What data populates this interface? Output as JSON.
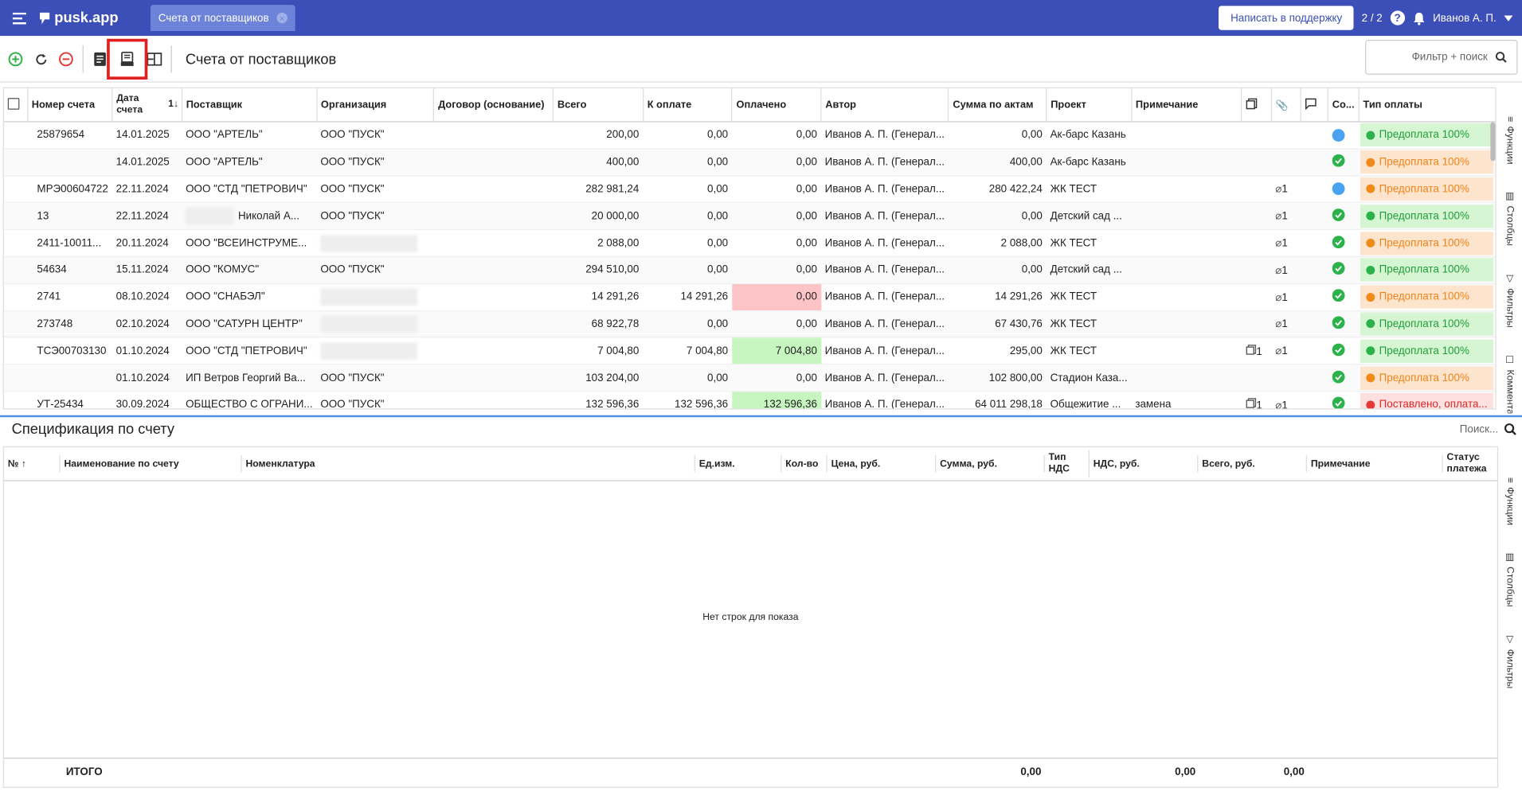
{
  "app": {
    "logo": "pusk.app",
    "tab": "Счета от поставщиков",
    "support": "Написать в поддержку",
    "counter": "2 / 2",
    "user": "Иванов А. П."
  },
  "toolbar": {
    "title": "Счета от поставщиков",
    "filter": "Фильтр + поиск"
  },
  "grid": {
    "headers": [
      "Номер счета",
      "Дата счета",
      "Поставщик",
      "Организация",
      "Договор (основание)",
      "Всего",
      "К оплате",
      "Оплачено",
      "Автор",
      "Сумма по актам",
      "Проект",
      "Примечание",
      "Со...",
      "Тип оплаты"
    ],
    "sort_label": "1",
    "rows": [
      {
        "num": "25879654",
        "date": "14.01.2025",
        "supplier": "ООО \"АРТЕЛЬ\"",
        "org": "ООО \"ПУСК\"",
        "total": "200,00",
        "topay": "0,00",
        "paid": "0,00",
        "author": "Иванов А. П. (Генерал...",
        "acts": "0,00",
        "project": "Ак-барс Казань",
        "note": "",
        "docs": "",
        "att": "",
        "st": "blue",
        "pay": "Предоплата 100%",
        "paycls": "green"
      },
      {
        "num": "",
        "date": "14.01.2025",
        "supplier": "ООО \"АРТЕЛЬ\"",
        "org": "ООО \"ПУСК\"",
        "total": "400,00",
        "topay": "0,00",
        "paid": "0,00",
        "author": "Иванов А. П. (Генерал...",
        "acts": "400,00",
        "project": "Ак-барс Казань",
        "note": "",
        "docs": "",
        "att": "",
        "st": "green",
        "pay": "Предоплата 100%",
        "paycls": "orange"
      },
      {
        "num": "МРЭ00604722",
        "date": "22.11.2024",
        "supplier": "ООО \"СТД \"ПЕТРОВИЧ\"",
        "org": "ООО \"ПУСК\"",
        "total": "282 981,24",
        "topay": "0,00",
        "paid": "0,00",
        "author": "Иванов А. П. (Генерал...",
        "acts": "280 422,24",
        "project": "ЖК ТЕСТ",
        "note": "",
        "docs": "",
        "att": "1",
        "st": "blue",
        "pay": "Предоплата 100%",
        "paycls": "orange"
      },
      {
        "num": "13",
        "date": "22.11.2024",
        "supplier": "Николай А...",
        "org": "ООО \"ПУСК\"",
        "total": "20 000,00",
        "topay": "0,00",
        "paid": "0,00",
        "author": "Иванов А. П. (Генерал...",
        "acts": "0,00",
        "project": "Детский сад ...",
        "note": "",
        "docs": "",
        "att": "1",
        "st": "green",
        "pay": "Предоплата 100%",
        "paycls": "green"
      },
      {
        "num": "2411-10011...",
        "date": "20.11.2024",
        "supplier": "ООО \"ВСЕИНСТРУМЕ...",
        "org": "",
        "total": "2 088,00",
        "topay": "0,00",
        "paid": "0,00",
        "author": "Иванов А. П. (Генерал...",
        "acts": "2 088,00",
        "project": "ЖК ТЕСТ",
        "note": "",
        "docs": "",
        "att": "1",
        "st": "green",
        "pay": "Предоплата 100%",
        "paycls": "orange"
      },
      {
        "num": "54634",
        "date": "15.11.2024",
        "supplier": "ООО \"КОМУС\"",
        "org": "ООО \"ПУСК\"",
        "total": "294 510,00",
        "topay": "0,00",
        "paid": "0,00",
        "author": "Иванов А. П. (Генерал...",
        "acts": "0,00",
        "project": "Детский сад ...",
        "note": "",
        "docs": "",
        "att": "1",
        "st": "green",
        "pay": "Предоплата 100%",
        "paycls": "green"
      },
      {
        "num": "2741",
        "date": "08.10.2024",
        "supplier": "ООО \"СНАБЭЛ\"",
        "org": "",
        "total": "14 291,26",
        "topay": "14 291,26",
        "paid": "0,00",
        "author": "Иванов А. П. (Генерал...",
        "acts": "14 291,26",
        "project": "ЖК ТЕСТ",
        "note": "",
        "docs": "",
        "att": "1",
        "st": "green",
        "pay": "Предоплата 100%",
        "paycls": "orange",
        "paidcls": "pink"
      },
      {
        "num": "273748",
        "date": "02.10.2024",
        "supplier": "ООО \"САТУРН ЦЕНТР\"",
        "org": "",
        "total": "68 922,78",
        "topay": "0,00",
        "paid": "0,00",
        "author": "Иванов А. П. (Генерал...",
        "acts": "67 430,76",
        "project": "ЖК ТЕСТ",
        "note": "",
        "docs": "",
        "att": "1",
        "st": "green",
        "pay": "Предоплата 100%",
        "paycls": "green"
      },
      {
        "num": "ТСЭ00703130",
        "date": "01.10.2024",
        "supplier": "ООО \"СТД \"ПЕТРОВИЧ\"",
        "org": "",
        "total": "7 004,80",
        "topay": "7 004,80",
        "paid": "7 004,80",
        "author": "Иванов А. П. (Генерал...",
        "acts": "295,00",
        "project": "ЖК ТЕСТ",
        "note": "",
        "docs": "1",
        "att": "1",
        "st": "green",
        "pay": "Предоплата 100%",
        "paycls": "green",
        "paidcls": "greenbg"
      },
      {
        "num": "",
        "date": "01.10.2024",
        "supplier": "ИП Ветров Георгий Ва...",
        "org": "ООО \"ПУСК\"",
        "total": "103 204,00",
        "topay": "0,00",
        "paid": "0,00",
        "author": "Иванов А. П. (Генерал...",
        "acts": "102 800,00",
        "project": "Стадион Каза...",
        "note": "",
        "docs": "",
        "att": "",
        "st": "green",
        "pay": "Предоплата 100%",
        "paycls": "orange"
      },
      {
        "num": "УТ-25434",
        "date": "30.09.2024",
        "supplier": "ОБЩЕСТВО С ОГРАНИ...",
        "org": "ООО \"ПУСК\"",
        "total": "132 596,36",
        "topay": "132 596,36",
        "paid": "132 596,36",
        "author": "Иванов А. П. (Генерал...",
        "acts": "64 011 298,18",
        "project": "Общежитие ...",
        "note": "замена",
        "docs": "1",
        "att": "1",
        "st": "green",
        "pay": "Поставлено, оплата...",
        "paycls": "red",
        "paidcls": "greenbg"
      }
    ]
  },
  "side": {
    "functions": "Функции",
    "columns": "Столбцы",
    "filters": "Фильтры",
    "comments": "Комментарии"
  },
  "spec": {
    "title": "Спецификация по счету",
    "search": "Поиск...",
    "headers": [
      "№",
      "Наименование по счету",
      "Номенклатура",
      "Ед.изм.",
      "Кол-во",
      "Цена, руб.",
      "Сумма, руб.",
      "Тип НДС",
      "НДС, руб.",
      "Всего, руб.",
      "Примечание",
      "Статус платежа"
    ],
    "empty": "Нет строк для показа",
    "total_label": "ИТОГО",
    "total_sum": "0,00",
    "total_vat": "0,00",
    "total_all": "0,00"
  }
}
